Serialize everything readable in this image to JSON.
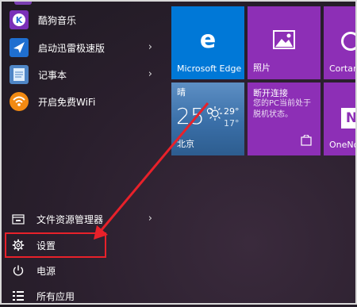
{
  "start_menu": {
    "apps": [
      {
        "label": "酷狗音乐",
        "icon": "kugou-icon",
        "has_submenu": false
      },
      {
        "label": "启动迅雷极速版",
        "icon": "thunder-icon",
        "has_submenu": true
      },
      {
        "label": "记事本",
        "icon": "notepad-icon",
        "has_submenu": true
      },
      {
        "label": "开启免费WiFi",
        "icon": "wifi-icon",
        "has_submenu": false
      }
    ],
    "system": [
      {
        "label": "文件资源管理器",
        "icon": "file-explorer-icon",
        "has_submenu": true
      },
      {
        "label": "设置",
        "icon": "gear-icon",
        "has_submenu": false
      },
      {
        "label": "电源",
        "icon": "power-icon",
        "has_submenu": false
      },
      {
        "label": "所有应用",
        "icon": "all-apps-icon",
        "has_submenu": false
      }
    ]
  },
  "tiles": {
    "edge": {
      "label": "Microsoft Edge",
      "color": "#0078d7"
    },
    "photos": {
      "label": "照片",
      "color": "#8d2fb6"
    },
    "cortana": {
      "label": "Cortana",
      "color": "#8d2fb6"
    },
    "weather": {
      "condition": "晴",
      "temp": "25°",
      "high": "29°",
      "low": "17°",
      "city": "北京",
      "color": "#3a6fa8"
    },
    "connect": {
      "title": "断开连接",
      "message": "您的PC当前处于脱机状态。",
      "color": "#8d2fb6"
    },
    "onenote": {
      "label": "OneNote",
      "color": "#8d2fb6"
    }
  },
  "annotation": {
    "color": "#e8212a"
  }
}
